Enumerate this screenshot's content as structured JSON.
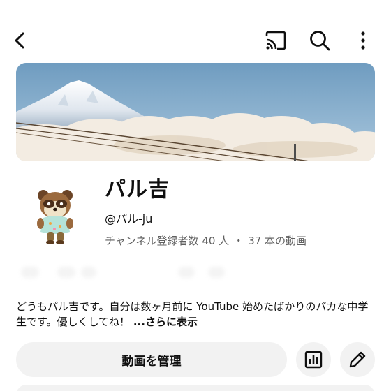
{
  "topbar": {
    "icons": [
      "back-arrow-icon",
      "cast-icon",
      "search-icon",
      "more-vertical-icon"
    ]
  },
  "channel": {
    "name": "パル吉",
    "handle": "@パル-ju",
    "subscribers": "チャンネル登録者数 40 人",
    "separator": "・",
    "videos": "37 本の動画"
  },
  "description": {
    "text": "どうもパル吉です。自分は数ヶ月前に YouTube 始めたばかりのバカな中学生です。優しくしてね！",
    "more_label": "...さらに表示"
  },
  "actions": {
    "manage_label": "動画を管理",
    "analytics_icon": "analytics-icon",
    "edit_icon": "pencil-icon"
  },
  "colors": {
    "text_primary": "#0f0f0f",
    "text_secondary": "#606060",
    "button_bg": "#f2f2f2",
    "sky": "#7fa8c9"
  }
}
